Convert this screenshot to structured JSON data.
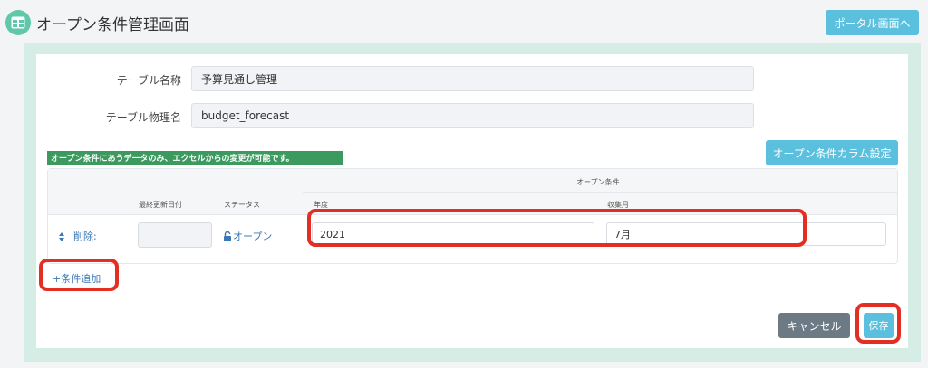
{
  "header": {
    "title": "オープン条件管理画面",
    "portal_button": "ポータル画面へ",
    "icon": "table-icon"
  },
  "form": {
    "table_name_label": "テーブル名称",
    "table_name_value": "予算見通し管理",
    "table_physical_label": "テーブル物理名",
    "table_physical_value": "budget_forecast"
  },
  "notice": "オープン条件にあうデータのみ、エクセルからの変更が可能です。",
  "column_settings_button": "オープン条件カラム設定",
  "grid": {
    "group_header": "オープン条件",
    "headers": {
      "last_updated": "最終更新日付",
      "status": "ステータス",
      "year": "年度",
      "month": "収集月"
    },
    "row": {
      "delete_label": "削除:",
      "last_updated": "",
      "status": "オープン",
      "year": "2021",
      "month": "7月"
    }
  },
  "add_condition": "+条件追加",
  "footer": {
    "cancel": "キャンセル",
    "save": "保存"
  },
  "colors": {
    "accent": "#5bc0de",
    "highlight": "#e32f23",
    "notice_bg": "#3c9a5f"
  }
}
